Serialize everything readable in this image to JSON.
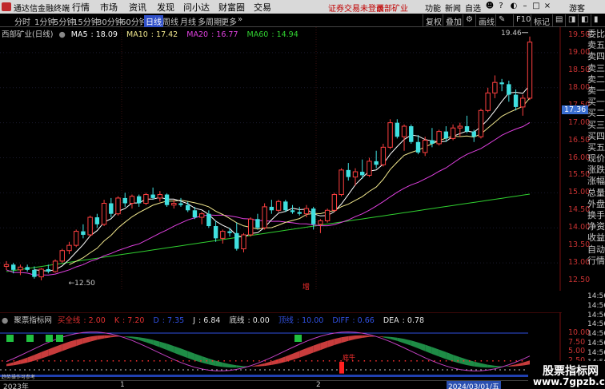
{
  "app": {
    "title": "通达信金融终端",
    "menus": [
      "行情",
      "市场",
      "资讯",
      "发现",
      "问小达",
      "财富圈",
      "交易"
    ],
    "notice": "证券交易未登录",
    "stock_tag": "西部矿业",
    "right_menus": [
      "功能",
      "新闻",
      "自选",
      "游客"
    ]
  },
  "toolbar": {
    "periods": [
      "分时",
      "1分钟",
      "5分钟",
      "15分钟",
      "30分钟",
      "60分钟",
      "日线",
      "周线",
      "月线",
      "多周期",
      "更多"
    ],
    "active_period": "日线",
    "right_buttons": [
      "复权",
      "叠加",
      "画线",
      "F10",
      "标记"
    ]
  },
  "main_chart": {
    "stock_name": "西部矿业(日线)",
    "ma": [
      {
        "label": "MA5",
        "value": "18.09",
        "color": "#ffffff"
      },
      {
        "label": "MA10",
        "value": "17.42",
        "color": "#f0e68c"
      },
      {
        "label": "MA20",
        "value": "16.77",
        "color": "#e040e0"
      },
      {
        "label": "MA60",
        "value": "14.94",
        "color": "#30d030"
      }
    ],
    "high_label": "19.46",
    "low_label": "12.50",
    "price_axis": [
      "19.50",
      "19.00",
      "18.50",
      "18.00",
      "17.50",
      "17.00",
      "16.50",
      "16.00",
      "15.50",
      "15.00",
      "14.50",
      "14.00",
      "13.50",
      "13.00",
      "12.50"
    ],
    "current_price": "17.36",
    "marker_text": "增",
    "candles": [
      [
        12.9,
        13.05,
        12.8,
        12.95
      ],
      [
        12.95,
        13.0,
        12.7,
        12.8
      ],
      [
        12.8,
        12.95,
        12.65,
        12.88
      ],
      [
        12.88,
        12.95,
        12.75,
        12.8
      ],
      [
        12.8,
        12.9,
        12.55,
        12.6
      ],
      [
        12.6,
        12.85,
        12.5,
        12.82
      ],
      [
        12.82,
        12.95,
        12.7,
        12.75
      ],
      [
        12.75,
        13.1,
        12.72,
        13.05
      ],
      [
        13.05,
        13.4,
        13.0,
        13.35
      ],
      [
        13.35,
        13.6,
        13.25,
        13.5
      ],
      [
        13.5,
        13.95,
        13.45,
        13.9
      ],
      [
        13.9,
        14.1,
        13.7,
        13.8
      ],
      [
        13.8,
        14.35,
        13.75,
        14.3
      ],
      [
        14.3,
        14.4,
        14.0,
        14.1
      ],
      [
        14.1,
        14.8,
        14.05,
        14.7
      ],
      [
        14.7,
        14.85,
        14.3,
        14.4
      ],
      [
        14.4,
        14.9,
        14.35,
        14.85
      ],
      [
        14.85,
        15.0,
        14.6,
        14.7
      ],
      [
        14.7,
        14.95,
        14.55,
        14.9
      ],
      [
        14.9,
        14.95,
        14.6,
        14.7
      ],
      [
        14.7,
        15.0,
        14.65,
        14.95
      ],
      [
        14.95,
        15.15,
        14.8,
        14.85
      ],
      [
        14.85,
        15.05,
        14.75,
        14.95
      ],
      [
        14.95,
        14.98,
        14.6,
        14.65
      ],
      [
        14.65,
        14.8,
        14.55,
        14.7
      ],
      [
        14.7,
        14.85,
        14.6,
        14.65
      ],
      [
        14.65,
        14.75,
        14.45,
        14.5
      ],
      [
        14.5,
        14.6,
        14.25,
        14.3
      ],
      [
        14.3,
        14.45,
        14.1,
        14.4
      ],
      [
        14.4,
        14.5,
        14.0,
        14.05
      ],
      [
        14.05,
        14.2,
        13.6,
        13.7
      ],
      [
        13.7,
        13.95,
        13.55,
        13.9
      ],
      [
        13.9,
        14.0,
        13.75,
        13.85
      ],
      [
        13.85,
        14.15,
        13.35,
        13.4
      ],
      [
        13.4,
        13.85,
        13.3,
        13.8
      ],
      [
        13.8,
        14.3,
        13.75,
        14.25
      ],
      [
        14.25,
        14.4,
        13.95,
        14.0
      ],
      [
        14.0,
        14.7,
        13.95,
        14.6
      ],
      [
        14.6,
        14.8,
        14.4,
        14.5
      ],
      [
        14.5,
        14.8,
        14.45,
        14.75
      ],
      [
        14.75,
        14.8,
        14.45,
        14.5
      ],
      [
        14.5,
        14.65,
        14.4,
        14.45
      ],
      [
        14.45,
        14.6,
        14.35,
        14.4
      ],
      [
        14.4,
        14.65,
        14.3,
        14.55
      ],
      [
        14.55,
        14.6,
        13.95,
        14.1
      ],
      [
        14.1,
        14.25,
        13.85,
        14.2
      ],
      [
        14.2,
        14.55,
        14.15,
        14.5
      ],
      [
        14.5,
        15.0,
        14.45,
        14.95
      ],
      [
        14.95,
        15.7,
        14.9,
        15.65
      ],
      [
        15.65,
        15.85,
        15.35,
        15.45
      ],
      [
        15.45,
        15.7,
        15.2,
        15.6
      ],
      [
        15.6,
        15.95,
        15.4,
        15.5
      ],
      [
        15.5,
        16.0,
        15.45,
        15.9
      ],
      [
        15.9,
        16.2,
        15.7,
        15.8
      ],
      [
        15.8,
        16.4,
        15.75,
        16.3
      ],
      [
        16.3,
        17.1,
        16.25,
        17.0
      ],
      [
        17.0,
        17.1,
        16.55,
        16.6
      ],
      [
        16.6,
        16.95,
        16.2,
        16.9
      ],
      [
        16.9,
        16.95,
        16.4,
        16.45
      ],
      [
        16.45,
        16.65,
        16.1,
        16.15
      ],
      [
        16.15,
        16.6,
        16.05,
        16.5
      ],
      [
        16.5,
        16.85,
        16.3,
        16.4
      ],
      [
        16.4,
        16.8,
        16.35,
        16.75
      ],
      [
        16.75,
        16.9,
        16.45,
        16.55
      ],
      [
        16.55,
        16.95,
        16.5,
        16.85
      ],
      [
        16.85,
        17.0,
        16.6,
        16.9
      ],
      [
        16.9,
        17.2,
        16.7,
        16.75
      ],
      [
        16.75,
        16.8,
        16.45,
        16.6
      ],
      [
        16.6,
        17.4,
        16.55,
        17.35
      ],
      [
        17.35,
        18.0,
        17.3,
        17.85
      ],
      [
        17.85,
        18.35,
        17.7,
        18.15
      ],
      [
        18.15,
        18.25,
        17.9,
        18.1
      ],
      [
        18.1,
        18.2,
        17.6,
        17.8
      ],
      [
        17.8,
        17.95,
        17.35,
        17.45
      ],
      [
        17.45,
        17.8,
        17.2,
        17.7
      ],
      [
        17.7,
        19.46,
        17.65,
        19.3
      ]
    ],
    "ma_visible": {
      "ma5_start": 4,
      "ma10_start": 9
    }
  },
  "indicator": {
    "name": "聚票指标网",
    "items": [
      {
        "label": "买全线",
        "value": "2.00",
        "color": "#e03030"
      },
      {
        "label": "K",
        "value": "7.20",
        "color": "#e03030"
      },
      {
        "label": "D",
        "value": "7.35",
        "color": "#3050e0"
      },
      {
        "label": "J",
        "value": "6.84",
        "color": "#e0e0e0"
      },
      {
        "label": "底线",
        "value": "0.00",
        "color": "#e0e0e0"
      },
      {
        "label": "顶线",
        "value": "10.00",
        "color": "#3050e0"
      },
      {
        "label": "DIFF",
        "value": "0.66",
        "color": "#3050e0"
      },
      {
        "label": "DEA",
        "value": "0.78",
        "color": "#e0e0e0"
      }
    ],
    "axis": [
      "10.00",
      "7.50",
      "5.00",
      "2.50"
    ],
    "buy_label": "买",
    "bottom_label": "底牛",
    "small_text": "趋势操作可参考"
  },
  "book": {
    "items": [
      "委比",
      "卖五",
      "卖四",
      "卖三",
      "卖二",
      "卖一",
      "买一",
      "买二",
      "买三",
      "买四",
      "买五",
      "现价",
      "涨跌",
      "涨幅",
      "总量",
      "外盘",
      "换手",
      "净资",
      "收益",
      "自动",
      "行情"
    ]
  },
  "ticks": [
    "14:56",
    "14:56",
    "14:56",
    "14:56",
    "14:56",
    "14:56",
    "14:56",
    "14:56",
    "14:56",
    "14:56"
  ],
  "dates": {
    "year": "2023年",
    "m1": "1",
    "m2": "2",
    "cursor": "2024/03/01/五"
  },
  "watermark": {
    "line1": "股票指标网",
    "line2": "www.7gpzb.com"
  }
}
